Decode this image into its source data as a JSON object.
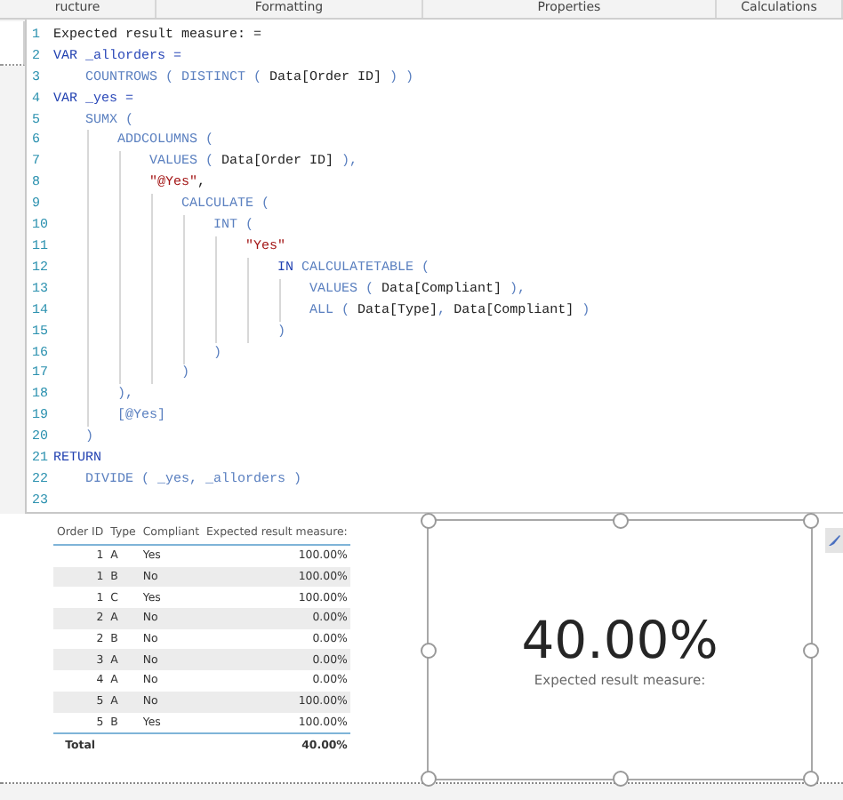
{
  "ribbon_tabs": [
    {
      "label": "ructure"
    },
    {
      "label": "Formatting"
    },
    {
      "label": "Properties"
    },
    {
      "label": "Calculations"
    }
  ],
  "formula_editor": {
    "lines": [
      {
        "number": "1",
        "tokens": [
          {
            "kind": "plain",
            "text": "Expected result measure: ="
          }
        ]
      },
      {
        "number": "2",
        "tokens": [
          {
            "kind": "keyword",
            "text": "VAR"
          },
          {
            "kind": "variable",
            "text": " _allorders ="
          }
        ]
      },
      {
        "number": "3",
        "tokens": [
          {
            "kind": "function",
            "text": "    COUNTROWS ( DISTINCT ( "
          },
          {
            "kind": "plain",
            "text": "Data[Order ID]"
          },
          {
            "kind": "function",
            "text": " ) )"
          }
        ]
      },
      {
        "number": "4",
        "tokens": [
          {
            "kind": "keyword",
            "text": "VAR"
          },
          {
            "kind": "variable",
            "text": " _yes ="
          }
        ]
      },
      {
        "number": "5",
        "tokens": [
          {
            "kind": "function",
            "text": "    SUMX ("
          }
        ]
      },
      {
        "number": "6",
        "tokens": [
          {
            "kind": "function",
            "text": "        ADDCOLUMNS ("
          }
        ]
      },
      {
        "number": "7",
        "tokens": [
          {
            "kind": "function",
            "text": "            VALUES ( "
          },
          {
            "kind": "plain",
            "text": "Data[Order ID]"
          },
          {
            "kind": "function",
            "text": " ),"
          }
        ]
      },
      {
        "number": "8",
        "tokens": [
          {
            "kind": "string",
            "text": "            \"@Yes\""
          },
          {
            "kind": "plain",
            "text": ","
          }
        ]
      },
      {
        "number": "9",
        "tokens": [
          {
            "kind": "function",
            "text": "                CALCULATE ("
          }
        ]
      },
      {
        "number": "10",
        "tokens": [
          {
            "kind": "function",
            "text": "                    INT ("
          }
        ]
      },
      {
        "number": "11",
        "tokens": [
          {
            "kind": "string",
            "text": "                        \"Yes\""
          }
        ]
      },
      {
        "number": "12",
        "tokens": [
          {
            "kind": "keyword",
            "text": "                            IN "
          },
          {
            "kind": "function",
            "text": "CALCULATETABLE ("
          }
        ]
      },
      {
        "number": "13",
        "tokens": [
          {
            "kind": "function",
            "text": "                                VALUES ( "
          },
          {
            "kind": "plain",
            "text": "Data[Compliant]"
          },
          {
            "kind": "function",
            "text": " ),"
          }
        ]
      },
      {
        "number": "14",
        "tokens": [
          {
            "kind": "function",
            "text": "                                ALL ( "
          },
          {
            "kind": "plain",
            "text": "Data[Type]"
          },
          {
            "kind": "function",
            "text": ", "
          },
          {
            "kind": "plain",
            "text": "Data[Compliant]"
          },
          {
            "kind": "function",
            "text": " )"
          }
        ]
      },
      {
        "number": "15",
        "tokens": [
          {
            "kind": "function",
            "text": "                            )"
          }
        ]
      },
      {
        "number": "16",
        "tokens": [
          {
            "kind": "function",
            "text": "                    )"
          }
        ]
      },
      {
        "number": "17",
        "tokens": [
          {
            "kind": "function",
            "text": "                )"
          }
        ]
      },
      {
        "number": "18",
        "tokens": [
          {
            "kind": "function",
            "text": "        ),"
          }
        ]
      },
      {
        "number": "19",
        "tokens": [
          {
            "kind": "function",
            "text": "        [@Yes]"
          }
        ]
      },
      {
        "number": "20",
        "tokens": [
          {
            "kind": "function",
            "text": "    )"
          }
        ]
      },
      {
        "number": "21",
        "tokens": [
          {
            "kind": "keyword",
            "text": "RETURN"
          }
        ]
      },
      {
        "number": "22",
        "tokens": [
          {
            "kind": "function",
            "text": "    DIVIDE ( _yes, _allorders )"
          }
        ]
      },
      {
        "number": "23"
      }
    ]
  },
  "table": {
    "columns": [
      "Order ID",
      "Type",
      "Compliant",
      "Expected result measure:"
    ],
    "rows": [
      [
        "1",
        "A",
        "Yes",
        "100.00%"
      ],
      [
        "1",
        "B",
        "No",
        "100.00%"
      ],
      [
        "1",
        "C",
        "Yes",
        "100.00%"
      ],
      [
        "2",
        "A",
        "No",
        "0.00%"
      ],
      [
        "2",
        "B",
        "No",
        "0.00%"
      ],
      [
        "3",
        "A",
        "No",
        "0.00%"
      ],
      [
        "4",
        "A",
        "No",
        "0.00%"
      ],
      [
        "5",
        "A",
        "No",
        "100.00%"
      ],
      [
        "5",
        "B",
        "Yes",
        "100.00%"
      ]
    ],
    "total": {
      "label": "Total",
      "value": "40.00%"
    }
  },
  "card": {
    "value": "40.00%",
    "label": "Expected result measure:",
    "selected": true
  }
}
